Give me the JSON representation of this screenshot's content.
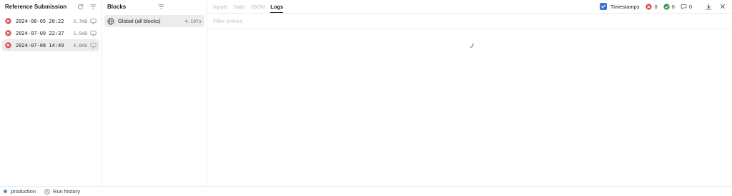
{
  "submissions_panel": {
    "title": "Reference Submission",
    "items": [
      {
        "date": "2024-08-05 20:22",
        "size": "3.7KB",
        "status": "failed"
      },
      {
        "date": "2024-07-09 22:37",
        "size": "5.5KB",
        "status": "failed"
      },
      {
        "date": "2024-07-08 14:49",
        "size": "4.8KB",
        "status": "failed",
        "selected": true
      }
    ]
  },
  "blocks_panel": {
    "title": "Blocks",
    "items": [
      {
        "label": "Global (all blocks)",
        "time": "4.197s",
        "selected": true
      }
    ]
  },
  "main": {
    "tabs": [
      {
        "label": "Inputs",
        "active": false
      },
      {
        "label": "Data",
        "active": false
      },
      {
        "label": "JSON",
        "active": false
      },
      {
        "label": "Logs",
        "active": true
      }
    ],
    "timestamps_label": "Timestamps",
    "timestamps_checked": true,
    "error_count": "0",
    "success_count": "0",
    "message_count": "0",
    "filter_placeholder": "Filter entries",
    "filter_value": ""
  },
  "bottom_bar": {
    "environment": "production",
    "run_history_label": "Run history"
  },
  "colors": {
    "error": "#d64545",
    "success": "#2e9a4e",
    "accent": "#3b73d9",
    "environment_dot": "#4a90c8",
    "selected_row": "#ececec"
  },
  "icons": {
    "refresh": "refresh-icon",
    "filter": "filter-icon",
    "failed": "error-circle-icon",
    "monitor": "monitor-icon",
    "globe": "globe-icon",
    "download": "download-icon",
    "close": "close-icon",
    "comment": "comment-icon",
    "history": "clock-icon",
    "loading": "spinner-icon"
  }
}
